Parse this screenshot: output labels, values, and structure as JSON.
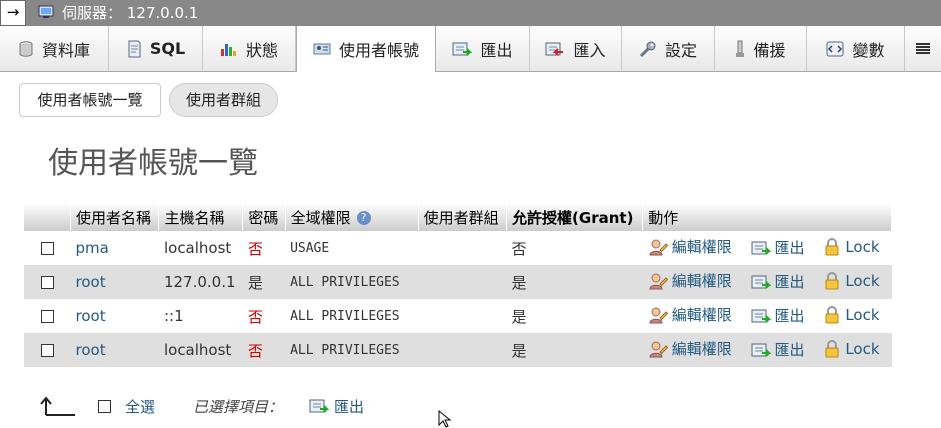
{
  "topbar": {
    "arrow": "→",
    "title": "伺服器： 127.0.0.1"
  },
  "tabs": [
    {
      "label": "資料庫",
      "icon": "database-icon"
    },
    {
      "label": "SQL",
      "icon": "sql-icon"
    },
    {
      "label": "狀態",
      "icon": "status-chart-icon"
    },
    {
      "label": "使用者帳號",
      "icon": "users-icon",
      "active": true
    },
    {
      "label": "匯出",
      "icon": "export-icon"
    },
    {
      "label": "匯入",
      "icon": "import-icon"
    },
    {
      "label": "設定",
      "icon": "wrench-icon"
    },
    {
      "label": "備援",
      "icon": "replication-icon"
    },
    {
      "label": "變數",
      "icon": "variables-icon"
    },
    {
      "label": "",
      "icon": "more-menu-icon"
    }
  ],
  "subtabs": {
    "overview": "使用者帳號一覽",
    "groups": "使用者群組"
  },
  "heading": "使用者帳號一覽",
  "table": {
    "headers": {
      "username": "使用者名稱",
      "hostname": "主機名稱",
      "password": "密碼",
      "global_privileges": "全域權限",
      "user_group": "使用者群組",
      "grant": "允許授權(Grant)",
      "action": "動作"
    },
    "rows": [
      {
        "user": "pma",
        "host": "localhost",
        "password": "否",
        "privileges": "USAGE",
        "group": "",
        "grant": "否"
      },
      {
        "user": "root",
        "host": "127.0.0.1",
        "password": "是",
        "privileges": "ALL PRIVILEGES",
        "group": "",
        "grant": "是"
      },
      {
        "user": "root",
        "host": "::1",
        "password": "否",
        "privileges": "ALL PRIVILEGES",
        "group": "",
        "grant": "是"
      },
      {
        "user": "root",
        "host": "localhost",
        "password": "否",
        "privileges": "ALL PRIVILEGES",
        "group": "",
        "grant": "是"
      }
    ],
    "actions": {
      "edit": "編輯權限",
      "export": "匯出",
      "lock": "Lock"
    }
  },
  "footer": {
    "check_all": "全選",
    "with_selected": "已選擇項目：",
    "export": "匯出"
  },
  "colors": {
    "link": "#235a81",
    "no_password": "#cc0000",
    "row_alt": "#dfdfdf"
  }
}
